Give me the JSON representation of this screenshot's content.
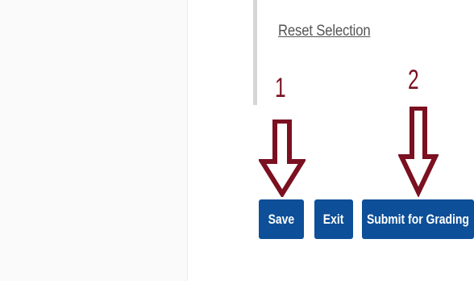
{
  "selection": {
    "reset_label": "Reset Selection"
  },
  "annotations": {
    "step1": "1",
    "step2": "2",
    "arrow_color": "#7a1020"
  },
  "actions": {
    "save_label": "Save",
    "exit_label": "Exit",
    "submit_label": "Submit for Grading",
    "button_color": "#0d4f98"
  }
}
